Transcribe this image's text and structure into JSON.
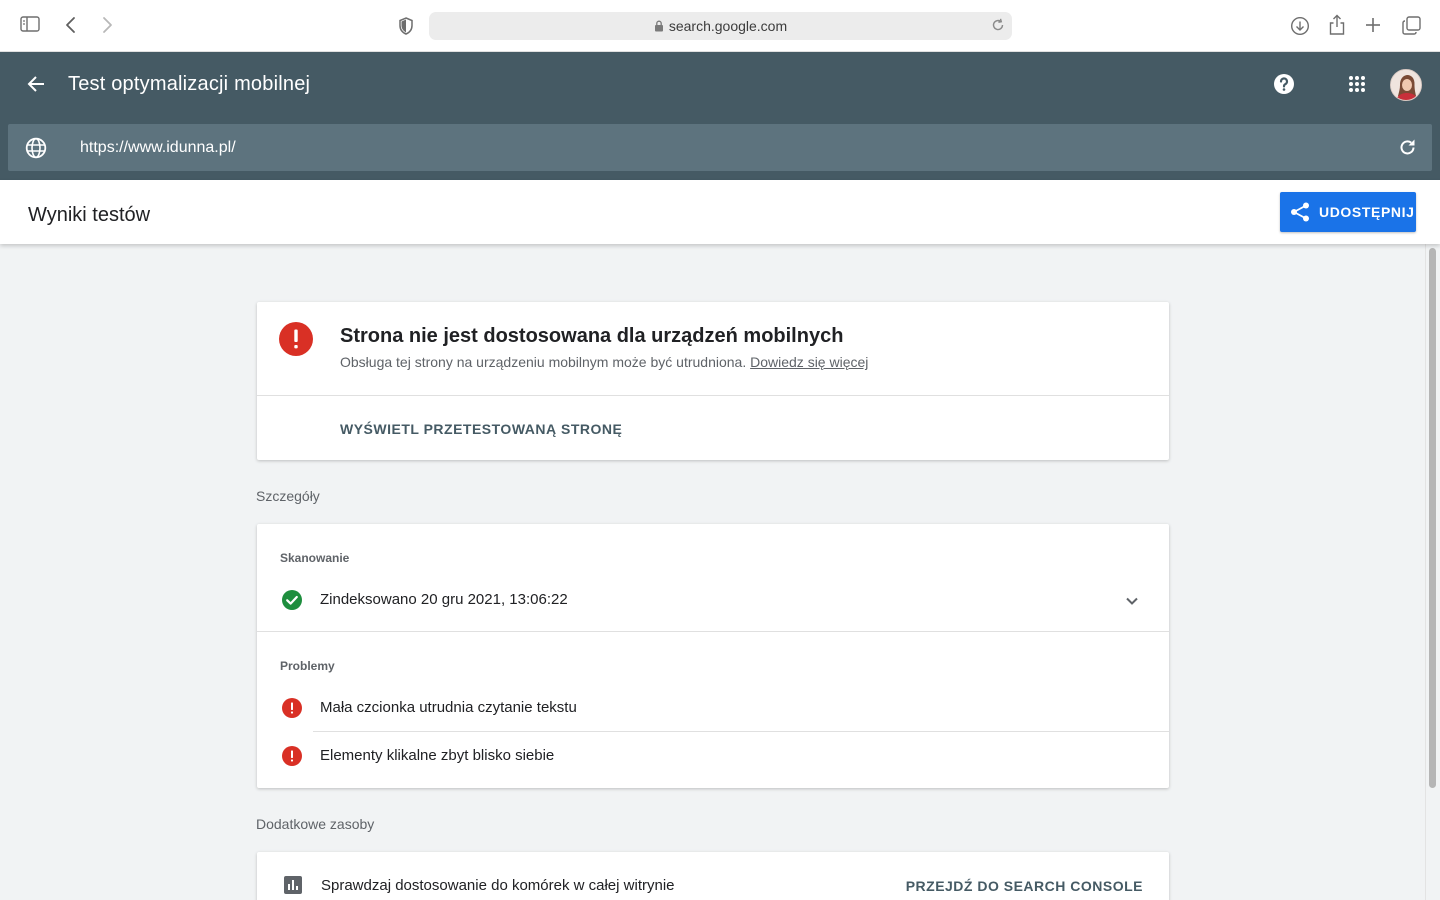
{
  "browser": {
    "address": "search.google.com",
    "icons": [
      "sidebar-icon",
      "back-icon",
      "forward-icon",
      "shield-icon",
      "lock-icon",
      "reload-icon",
      "download-icon",
      "share-icon",
      "new-tab-icon",
      "tabs-overview-icon"
    ]
  },
  "appbar": {
    "title": "Test optymalizacji mobilnej",
    "url": "https://www.idunna.pl/",
    "icons": [
      "back-arrow-icon",
      "help-icon",
      "apps-grid-icon",
      "avatar",
      "globe-icon",
      "refresh-icon"
    ]
  },
  "results": {
    "title": "Wyniki testów",
    "share_label": "UDOSTĘPNIJ"
  },
  "verdict": {
    "headline": "Strona nie jest dostosowana dla urządzeń mobilnych",
    "description": "Obsługa tej strony na urządzeniu mobilnym może być utrudniona.",
    "learn_more": "Dowiedz się więcej",
    "view_page": "WYŚWIETL PRZETESTOWANĄ STRONĘ"
  },
  "details": {
    "section_label": "Szczegóły",
    "crawl_label": "Skanowanie",
    "crawl_status": "Zindeksowano 20 gru 2021, 13:06:22",
    "problems_label": "Problemy",
    "problems": [
      "Mała czcionka utrudnia czytanie tekstu",
      "Elementy klikalne zbyt blisko siebie"
    ]
  },
  "resources": {
    "section_label": "Dodatkowe zasoby",
    "item_text": "Sprawdzaj dostosowanie do komórek w całej witrynie",
    "item_button": "PRZEJDŹ DO SEARCH CONSOLE"
  },
  "colors": {
    "appbar": "#455a64",
    "urlbar": "#5d737e",
    "accent": "#1a73e8",
    "error": "#d93025",
    "success": "#1e8e3e"
  }
}
